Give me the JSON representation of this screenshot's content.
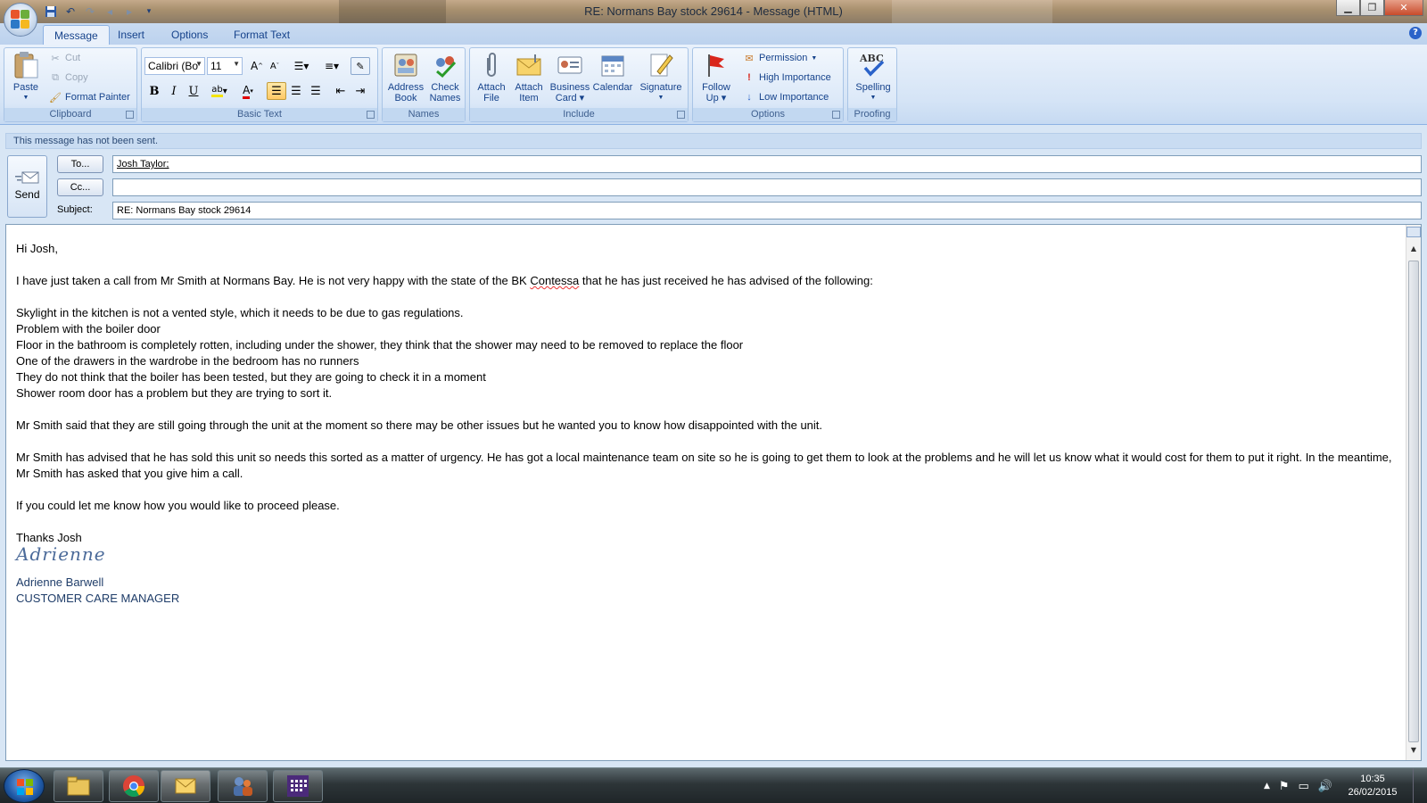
{
  "window": {
    "title": "RE: Normans Bay stock 29614 - Message (HTML)"
  },
  "ribbon": {
    "tabs": [
      "Message",
      "Insert",
      "Options",
      "Format Text"
    ],
    "clipboard": {
      "paste": "Paste",
      "cut": "Cut",
      "copy": "Copy",
      "format_painter": "Format Painter",
      "label": "Clipboard"
    },
    "basic_text": {
      "font": "Calibri (Bo",
      "size": "11",
      "label": "Basic Text"
    },
    "names": {
      "address_book_1": "Address",
      "address_book_2": "Book",
      "check_names_1": "Check",
      "check_names_2": "Names",
      "label": "Names"
    },
    "include": {
      "attach_file_1": "Attach",
      "attach_file_2": "File",
      "attach_item_1": "Attach",
      "attach_item_2": "Item",
      "business_card_1": "Business",
      "business_card_2": "Card",
      "calendar": "Calendar",
      "signature": "Signature",
      "label": "Include"
    },
    "options": {
      "follow_up_1": "Follow",
      "follow_up_2": "Up",
      "permission": "Permission",
      "high_importance": "High Importance",
      "low_importance": "Low Importance",
      "label": "Options"
    },
    "proofing": {
      "spelling": "Spelling",
      "label": "Proofing"
    }
  },
  "compose": {
    "status": "This message has not been sent.",
    "send": "Send",
    "to_button": "To...",
    "cc_button": "Cc...",
    "subject_label": "Subject:",
    "to_value": "Josh Taylor;",
    "cc_value": "",
    "subject_value": "RE: Normans Bay stock 29614"
  },
  "body": {
    "greeting": "Hi Josh,",
    "para1_a": "I have just taken a call from Mr Smith at Normans Bay.  He is not very happy with the state of the BK ",
    "para1_word": "Contessa",
    "para1_b": " that he has just received he has advised of the following:",
    "issues": [
      "Skylight in the kitchen is not a vented style, which it needs to be due to gas regulations.",
      "Problem with the boiler door",
      "Floor in the bathroom is completely rotten, including under the shower, they think that the shower may need to be removed to replace the floor",
      "One of the drawers in the wardrobe in the bedroom has no runners",
      "They do not think that the boiler has been tested, but they are going to check it in a moment",
      "Shower room door has a problem but they are trying to sort it."
    ],
    "para2": "Mr Smith said that they are still going through the unit at the moment so there may be other issues but he wanted you to know how disappointed with the unit.",
    "para3": "Mr Smith has advised that he has sold this unit so needs this sorted as a matter of urgency.  He has got a local maintenance team on site so he is going to get them to look at the problems and he will let us know what it would cost for them to put it right.  In the meantime, Mr Smith has asked that you give him a call.",
    "para4": "If you could let me know how you would like to proceed please.",
    "closing": "Thanks Josh",
    "signature_script": "Adrienne",
    "signature_name": "Adrienne Barwell",
    "signature_title": "CUSTOMER CARE MANAGER"
  },
  "taskbar": {
    "time": "10:35",
    "date": "26/02/2015"
  }
}
